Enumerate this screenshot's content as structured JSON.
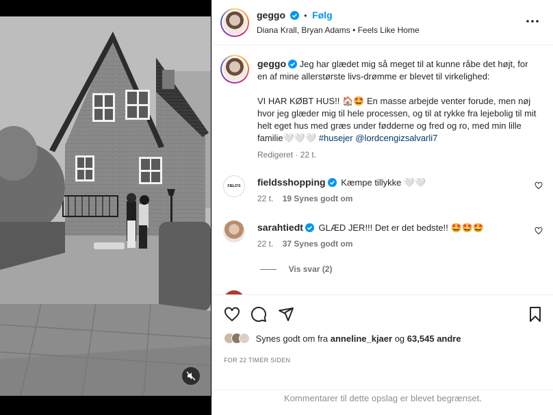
{
  "post_header": {
    "username": "geggo",
    "dot": "•",
    "follow_label": "Følg",
    "subtitle": "Diana Krall, Bryan Adams • Feels Like Home"
  },
  "caption": {
    "username": "geggo",
    "line1": "Jeg har glædet mig så meget til at kunne råbe det højt, for en af mine allerstørste livs-drømme er blevet til virkelighed:",
    "line2_start": "VI HAR KØBT HUS!! 🏠🤩 En masse arbejde venter forude, men nøj hvor jeg glæder mig til hele processen, og til at rykke fra lejebolig til mit helt eget hus med græs under fødderne og fred og ro, med min lille familie🤍🤍🤍 ",
    "hashtag": "#husejer",
    "mention": "@lordcengizsalvarli7",
    "meta": "Redigeret · 22 t."
  },
  "comments": [
    {
      "username": "fieldsshopping",
      "text": "Kæmpe tillykke 🤍🤍",
      "time": "22 t.",
      "likes": "19 Synes godt om",
      "avatar_text": "FIELD'S"
    },
    {
      "username": "sarahtiedt",
      "text": "GLÆD JER!!! Det er det bedste!! 🤩🤩🤩",
      "time": "22 t.",
      "likes": "37 Synes godt om"
    }
  ],
  "view_replies": "Vis svar (2)",
  "likes": {
    "prefix": "Synes godt om fra",
    "user": "anneline_kjaer",
    "and": "og",
    "count": "63,545",
    "suffix": "andre"
  },
  "timestamp": "FOR 22 TIMER SIDEN",
  "restricted_msg": "Kommentarer til dette opslag er blevet begrænset.",
  "colors": {
    "accent": "#0095f6",
    "link": "#00376b",
    "muted": "#737373"
  }
}
